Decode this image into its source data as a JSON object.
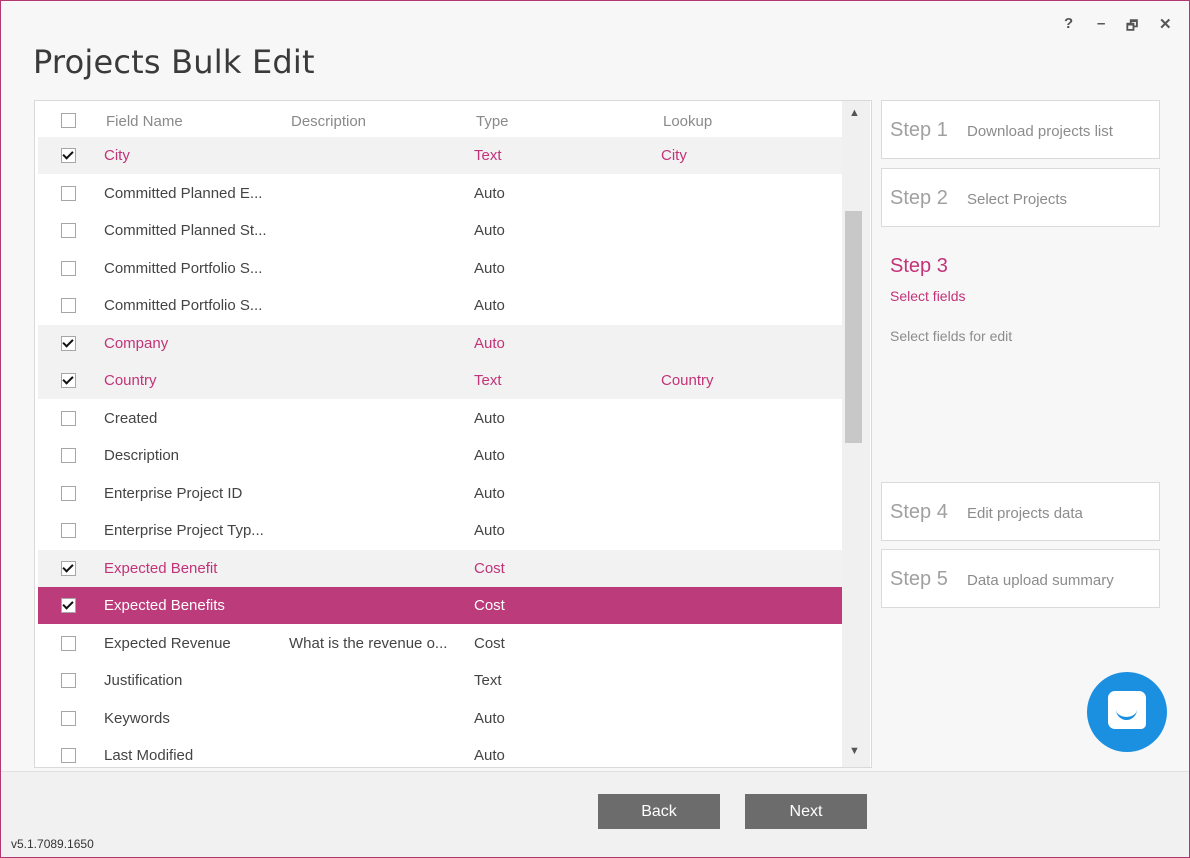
{
  "window": {
    "title": "Projects Bulk Edit",
    "controls": {
      "help": "?",
      "minimize": "–",
      "restore": "🗗",
      "close": "✕"
    }
  },
  "grid": {
    "headers": {
      "field_name": "Field Name",
      "description": "Description",
      "type": "Type",
      "lookup": "Lookup"
    },
    "rows": [
      {
        "name": "City",
        "description": "",
        "type": "Text",
        "lookup": "City",
        "checked": true,
        "selected": false
      },
      {
        "name": "Committed Planned E...",
        "description": "",
        "type": "Auto",
        "lookup": "",
        "checked": false,
        "selected": false
      },
      {
        "name": "Committed Planned St...",
        "description": "",
        "type": "Auto",
        "lookup": "",
        "checked": false,
        "selected": false
      },
      {
        "name": "Committed Portfolio S...",
        "description": "",
        "type": "Auto",
        "lookup": "",
        "checked": false,
        "selected": false
      },
      {
        "name": "Committed Portfolio S...",
        "description": "",
        "type": "Auto",
        "lookup": "",
        "checked": false,
        "selected": false
      },
      {
        "name": "Company",
        "description": "",
        "type": "Auto",
        "lookup": "",
        "checked": true,
        "selected": false
      },
      {
        "name": "Country",
        "description": "",
        "type": "Text",
        "lookup": "Country",
        "checked": true,
        "selected": false
      },
      {
        "name": "Created",
        "description": "",
        "type": "Auto",
        "lookup": "",
        "checked": false,
        "selected": false
      },
      {
        "name": "Description",
        "description": "",
        "type": "Auto",
        "lookup": "",
        "checked": false,
        "selected": false
      },
      {
        "name": "Enterprise Project ID",
        "description": "",
        "type": "Auto",
        "lookup": "",
        "checked": false,
        "selected": false
      },
      {
        "name": "Enterprise Project Typ...",
        "description": "",
        "type": "Auto",
        "lookup": "",
        "checked": false,
        "selected": false
      },
      {
        "name": "Expected Benefit",
        "description": "",
        "type": "Cost",
        "lookup": "",
        "checked": true,
        "selected": false
      },
      {
        "name": "Expected Benefits",
        "description": "",
        "type": "Cost",
        "lookup": "",
        "checked": true,
        "selected": true
      },
      {
        "name": "Expected Revenue",
        "description": "What is the revenue o...",
        "type": "Cost",
        "lookup": "",
        "checked": false,
        "selected": false
      },
      {
        "name": "Justification",
        "description": "",
        "type": "Text",
        "lookup": "",
        "checked": false,
        "selected": false
      },
      {
        "name": "Keywords",
        "description": "",
        "type": "Auto",
        "lookup": "",
        "checked": false,
        "selected": false
      },
      {
        "name": "Last Modified",
        "description": "",
        "type": "Auto",
        "lookup": "",
        "checked": false,
        "selected": false
      }
    ]
  },
  "steps": {
    "step1": {
      "number": "Step 1",
      "label": "Download projects list"
    },
    "step2": {
      "number": "Step 2",
      "label": "Select Projects"
    },
    "step3": {
      "number": "Step 3",
      "label": "Select fields",
      "description": "Select fields for edit"
    },
    "step4": {
      "number": "Step 4",
      "label": "Edit projects data"
    },
    "step5": {
      "number": "Step 5",
      "label": "Data upload summary"
    }
  },
  "footer": {
    "back_label": "Back",
    "next_label": "Next",
    "version": "v5.1.7089.1650"
  },
  "colors": {
    "accent": "#c23378",
    "selected_row": "#bc3b7a",
    "chat_button": "#1b8fe0",
    "button": "#6c6c6c"
  },
  "icons": {
    "help": "help-icon",
    "minimize": "minimize-icon",
    "restore": "restore-icon",
    "close": "close-icon",
    "chat": "chat-icon",
    "scroll_up": "chevron-up-icon",
    "scroll_down": "chevron-down-icon"
  }
}
